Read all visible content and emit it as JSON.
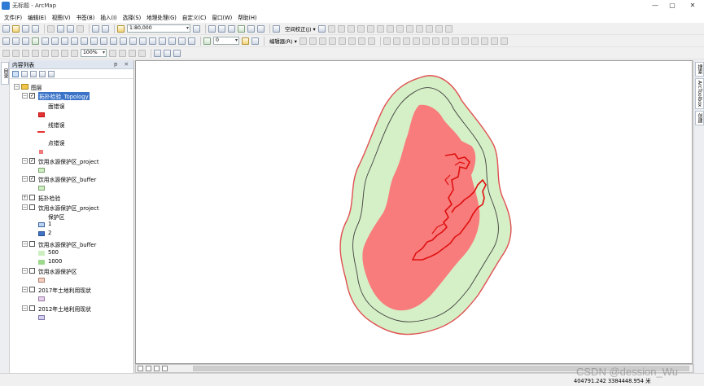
{
  "window": {
    "title": "无标题 - ArcMap",
    "controls": [
      "—",
      "▢",
      "✕"
    ]
  },
  "menu": [
    "文件(F)",
    "编辑(E)",
    "视图(V)",
    "书签(B)",
    "插入(I)",
    "选择(S)",
    "地理处理(G)",
    "自定义(C)",
    "窗口(W)",
    "帮助(H)"
  ],
  "toolbar": {
    "scale_value": "1:80,000",
    "spatial_adjust_label": "空间校正(J) ▾",
    "layer_combo_value": "0",
    "editor_label": "编辑器(R) ▾",
    "zoom_value": "100%"
  },
  "left_strip": {
    "tab": "目录"
  },
  "toc": {
    "title": "内容列表",
    "header_pins": "ᵽ ✕",
    "root_label": "图层",
    "layers": [
      {
        "name": "拓扑检验_Topology",
        "checked": true,
        "expanded": true,
        "selected": true,
        "legend": [
          {
            "label": "面错误",
            "swatch": "#e63333"
          },
          {
            "label": "线错误",
            "swatch": "#e63333"
          },
          {
            "label": "点错误",
            "swatch": "#f07a7a"
          }
        ]
      },
      {
        "name": "饮用水源保护区_project",
        "checked": true,
        "expanded": true,
        "swatch": "#cfeec3"
      },
      {
        "name": "饮用水源保护区_buffer",
        "checked": true,
        "expanded": true,
        "swatch": "#cfeec3"
      },
      {
        "name": "拓扑检验",
        "checked": false,
        "expanded": false
      },
      {
        "name": "饮用水源保护区_project",
        "checked": false,
        "expanded": true,
        "field": "保护区",
        "classes": [
          {
            "label": "1",
            "swatch": "#bcd4f4"
          },
          {
            "label": "2",
            "swatch": "#3f72c8"
          }
        ]
      },
      {
        "name": "饮用水源保护区_buffer",
        "checked": false,
        "expanded": true,
        "classes": [
          {
            "label": "500",
            "swatch": "#cdeec0"
          },
          {
            "label": "1000",
            "swatch": "#9ed88e"
          }
        ]
      },
      {
        "name": "饮用水源保护区",
        "checked": false,
        "expanded": true,
        "swatch": "#f2cfc0"
      },
      {
        "name": "2017年土地利用现状",
        "checked": false,
        "expanded": true,
        "swatch": "#e6d0ec"
      },
      {
        "name": "2012年土地利用现状",
        "checked": false,
        "expanded": true,
        "swatch": "#d6d0f0"
      }
    ]
  },
  "right_strip": {
    "tabs": [
      "搜索",
      "ArcToolbox",
      "创建"
    ]
  },
  "map": {
    "buffer_fill": "#d5efc6",
    "error_fill": "#f87c7c",
    "outline_color": "#e05050",
    "error_line_color": "#e01010"
  },
  "status": {
    "coords": "404791.242   3384448.954 米"
  },
  "watermark": "CSDN @dession_Wu"
}
